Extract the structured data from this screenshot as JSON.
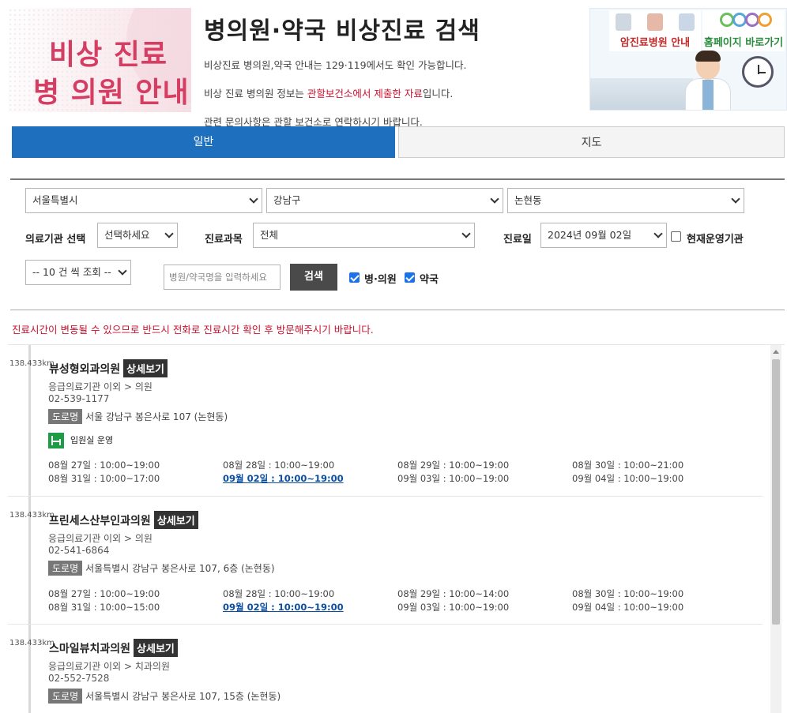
{
  "header": {
    "logo_line1": "비상 진료",
    "logo_line2": "병 의원 안내",
    "title": "병의원·약국 비상진료 검색",
    "desc1": "비상진료 병의원,약국 안내는 129·119에서도 확인 가능합니다.",
    "desc2_pre": "비상 진료 병의원 정보는 ",
    "desc2_highlight": "관할보건소에서 제출한 자료",
    "desc2_post": "입니다.",
    "desc3": "관련 문의사항은 관할 보건소로 연락하시기 바랍니다."
  },
  "banner": {
    "cancer_label": "암진료병원 안내",
    "homepage_label": "홈페이지 바로가기"
  },
  "tabs": {
    "general": "일반",
    "map": "지도"
  },
  "filters": {
    "city": "서울특별시",
    "district": "강남구",
    "dong": "논현동",
    "institution_label": "의료기관 선택",
    "institution_value": "선택하세요",
    "department_label": "진료과목",
    "department_value": "전체",
    "date_label": "진료일",
    "date_value": "2024년 09월 02일",
    "operating_label": "현재운영기관",
    "page_size": "-- 10 건 씩 조회 --",
    "search_placeholder": "병원/약국명을 입력하세요",
    "search_button": "검색",
    "hospital_check_label": "병·의원",
    "pharmacy_check_label": "약국"
  },
  "notice": "진료시간이 변동될 수 있으므로 반드시 전화로 진료시간 확인 후 방문해주시기 바랍니다.",
  "results": [
    {
      "distance": "138.433km",
      "name": "뷰성형외과의원",
      "detail": "상세보기",
      "category": "응급의료기관 이외 > 의원",
      "phone": "02-539-1177",
      "road_tag": "도로명",
      "address": "서울 강남구 봉은사로 107 (논현동)",
      "inpatient": "입원실 운영",
      "schedule": [
        "08월 27일 : 10:00~19:00",
        "08월 28일 : 10:00~19:00",
        "08월 29일 : 10:00~19:00",
        "08월 30일 : 10:00~21:00",
        "08월 31일 : 10:00~17:00",
        "09월 02일 : 10:00~19:00",
        "09월 03일 : 10:00~19:00",
        "09월 04일 : 10:00~19:00"
      ]
    },
    {
      "distance": "138.433km",
      "name": "프린세스산부인과의원",
      "detail": "상세보기",
      "category": "응급의료기관 이외 > 의원",
      "phone": "02-541-6864",
      "road_tag": "도로명",
      "address": "서울특별시 강남구 봉은사로 107, 6층 (논현동)",
      "schedule": [
        "08월 27일 : 10:00~19:00",
        "08월 28일 : 10:00~19:00",
        "08월 29일 : 10:00~14:00",
        "08월 30일 : 10:00~19:00",
        "08월 31일 : 10:00~15:00",
        "09월 02일 : 10:00~19:00",
        "09월 03일 : 10:00~19:00",
        "09월 04일 : 10:00~19:00"
      ]
    },
    {
      "distance": "138.433km",
      "name": "스마일뷰치과의원",
      "detail": "상세보기",
      "category": "응급의료기관 이외 > 치과의원",
      "phone": "02-552-7528",
      "road_tag": "도로명",
      "address": "서울특별시 강남구 봉은사로 107, 15층 (논현동)"
    }
  ],
  "colors": {
    "primary": "#1e6fbe",
    "accent_red": "#c8102e",
    "logo_pink": "#d63d63",
    "button_dark": "#4a4a4a",
    "inpatient_green": "#1c9c45",
    "today_link": "#0b4ea2"
  }
}
